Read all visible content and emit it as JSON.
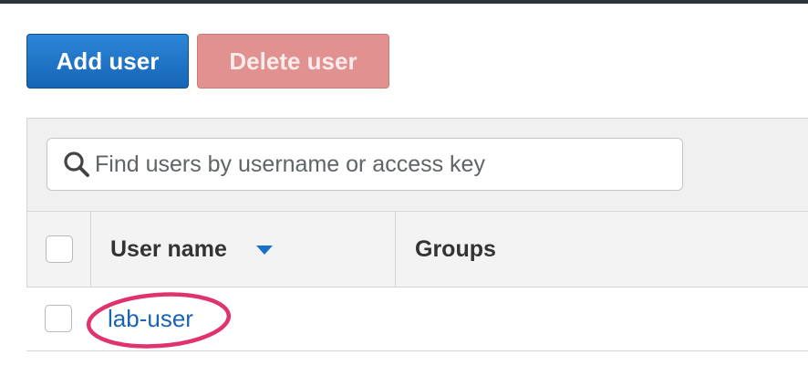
{
  "buttons": {
    "add_user": "Add user",
    "delete_user": "Delete user"
  },
  "search": {
    "placeholder": "Find users by username or access key",
    "value": ""
  },
  "table": {
    "columns": [
      "User name",
      "Groups"
    ],
    "sort": {
      "column": "User name",
      "direction": "descending"
    },
    "rows": [
      {
        "user_name": "lab-user",
        "groups": "",
        "selected": false
      }
    ]
  },
  "annotation": {
    "highlight_color": "#e0336b",
    "highlighted_item": "lab-user"
  },
  "colors": {
    "primary": "#1565b6",
    "danger_disabled": "#e29191",
    "link": "#1a64b3",
    "sort_arrow": "#1a6fc9"
  }
}
